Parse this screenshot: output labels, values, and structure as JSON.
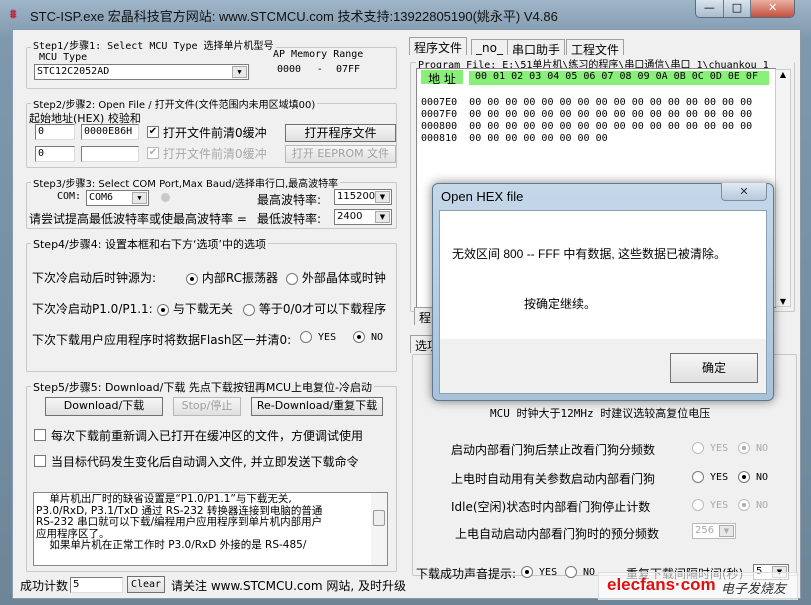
{
  "window": {
    "title": "STC-ISP.exe   宏晶科技官方网站: www.STCMCU.com  技术支持:13922805190(姚永平)  V4.86",
    "minimize": "—",
    "maximize": "□",
    "close": "✕"
  },
  "step1": {
    "title": "Step1/步骤1: Select MCU Type  选择单片机型号",
    "mcu_label": "MCU Type",
    "mcu_value": "STC12C2052AD",
    "ap_label": "AP Memory Range",
    "ap_start": "0000",
    "ap_dash": "-",
    "ap_end": "07FF"
  },
  "step2": {
    "title": "Step2/步骤2: Open File / 打开文件(文件范围内未用区域填00)",
    "sub": "起始地址(HEX) 校验和",
    "addr1": "0",
    "checksum1": "0000E86H",
    "clear1": "打开文件前清0缓冲",
    "open_prog": "打开程序文件",
    "addr2": "0",
    "checksum2": "",
    "clear2": "打开文件前清0缓冲",
    "open_eeprom": "打开 EEPROM 文件"
  },
  "step3": {
    "title": "Step3/步骤3: Select COM Port,Max Baud/选择串行口,最高波特率",
    "com_label": "COM:",
    "com_value": "COM6",
    "max_label": "最高波特率:",
    "max_value": "115200",
    "hint": "请尝试提高最低波特率或使最高波特率 =",
    "min_label": "最低波特率:",
    "min_value": "2400"
  },
  "step4": {
    "title": "Step4/步骤4: 设置本框和右下方‘选项’中的选项",
    "r1": {
      "label": "下次冷启动后时钟源为:",
      "a": "内部RC振荡器",
      "b": "外部晶体或时钟"
    },
    "r2": {
      "label": "下次冷启动P1.0/P1.1:",
      "a": "与下载无关",
      "b": "等于0/0才可以下载程序"
    },
    "r3": {
      "label": "下次下载用户应用程序时将数据Flash区一并清0:",
      "a": "YES",
      "b": "NO"
    }
  },
  "step5": {
    "title": "Step5/步骤5: Download/下载  先点下载按钮再MCU上电复位-冷启动",
    "download": "Download/下载",
    "stop": "Stop/停止",
    "redownload": "Re-Download/重复下载",
    "cb1": "每次下载前重新调入已打开在缓冲区的文件，方便调试使用",
    "cb2": "当目标代码发生变化后自动调入文件, 并立即发送下载命令",
    "info": [
      "    单片机出厂时的缺省设置是“P1.0/P1.1”与下载无关,",
      "P3.0/RxD, P3.1/TxD 通过 RS-232 转换器连接到电脑的普通",
      "RS-232 串口就可以下载/编程用户应用程序到单片机内部用户",
      "应用程序区了。",
      "    如果单片机在正常工作时 P3.0/RxD 外接的是 RS-485/"
    ]
  },
  "status": {
    "count_label": "成功计数",
    "count_value": "5",
    "clear": "Clear",
    "notice": "请关注 www.STCMCU.com 网站, 及时升级"
  },
  "tabs": [
    "程序文件",
    "_no_",
    "串口助手",
    "工程文件"
  ],
  "program_file": {
    "label": "Program File: E:\\51单片机\\练习的程序\\串口通信\\串口_1\\chuankou_1",
    "addr_header": "地 址",
    "col_header": "00 01 02 03 04 05 06 07 08 09 0A 0B 0C 0D 0E 0F",
    "rows": [
      {
        "addr": "0007E0",
        "data": "00 00 00 00 00 00 00 00 00 00 00 00 00 00 00 00"
      },
      {
        "addr": "0007F0",
        "data": "00 00 00 00 00 00 00 00 00 00 00 00 00 00 00 00"
      },
      {
        "addr": "000800",
        "data": "00 00 00 00 00 00 00 00 00 00 00 00 00 00 00 00"
      },
      {
        "addr": "000810",
        "data": "00 00 00 00 00 00 00 00"
      }
    ],
    "bottom_tab": "程"
  },
  "options": {
    "tab": "选项",
    "note": "MCU 时钟大于12MHz 时建议选较高复位电压",
    "rows": [
      {
        "label": "启动内部看门狗后禁止改看门狗分频数",
        "yes": "YES",
        "no": "NO"
      },
      {
        "label": "上电时自动用有关参数启动内部看门狗",
        "yes": "YES",
        "no": "NO"
      },
      {
        "label": "Idle(空闲)状态时内部看门狗停止计数",
        "yes": "YES",
        "no": "NO"
      }
    ],
    "prescale_label": "上电自动启动内部看门狗时的预分频数",
    "prescale_value": "256",
    "sound_label": "下载成功声音提示:",
    "sound_yes": "YES",
    "sound_no": "NO",
    "interval_label": "重复下载间隔时间(秒)",
    "interval_value": "5"
  },
  "dialog": {
    "title": "Open HEX file",
    "close": "✕",
    "message": "无效区间 800 -- FFF 中有数据, 这些数据已被清除。",
    "prompt": "按确定继续。",
    "ok": "确定"
  },
  "watermark": {
    "text": "elecfans·com",
    "cn": "电子发烧友"
  }
}
